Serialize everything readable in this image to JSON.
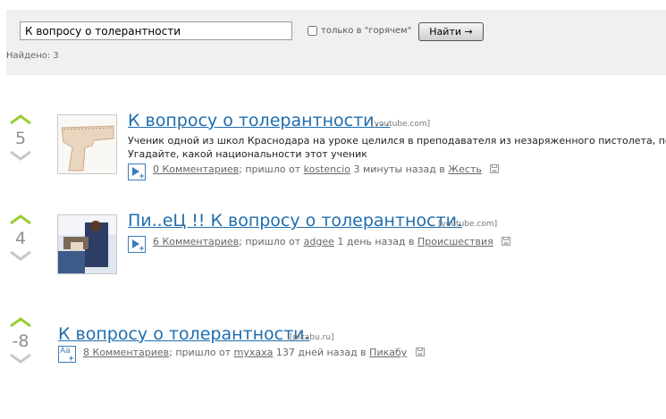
{
  "search": {
    "query": "К вопросу о толерантности",
    "hot_only_label": "только в \"горячем\"",
    "hot_only_checked": false,
    "button_label": "Найти →",
    "found_text": "Найдено: 3"
  },
  "stories": [
    {
      "score": "5",
      "title": "К вопросу о толерантности...",
      "domain": "[youtube.com]",
      "description": [
        "Ученик одной из школ Краснодара на уроке целился в преподавателя из незаряженного пистолета, после",
        "Угадайте, какой национальности этот ученик"
      ],
      "comments": "0 Комментариев",
      "from_text": "; пришло от",
      "author": "kostencio",
      "time_text": "3 минуты назад в",
      "category": "Жесть",
      "type_icon": "video-add-icon"
    },
    {
      "score": "4",
      "title": "Пи..еЦ !! К вопросу о толерантности.",
      "domain": "[youtube.com]",
      "comments": "6 Комментариев",
      "from_text": "; пришло от",
      "author": "adgee",
      "time_text": "1 день назад в",
      "category": "Происшествия",
      "type_icon": "video-add-icon"
    },
    {
      "score": "-8",
      "title": "К вопросу о толерантности.",
      "domain": "[pikabu.ru]",
      "comments": "8 Комментариев",
      "from_text": "; пришло от",
      "author": "myxaxa",
      "time_text": "137 дней назад в",
      "category": "Пикабу",
      "type_icon": "text-add-icon",
      "type_icon_label": "Aa"
    }
  ],
  "colors": {
    "link": "#1f6dae",
    "vote_up": "#9acd32",
    "vote_down": "#c8c8c8",
    "icon_border": "#3d7bb9"
  }
}
